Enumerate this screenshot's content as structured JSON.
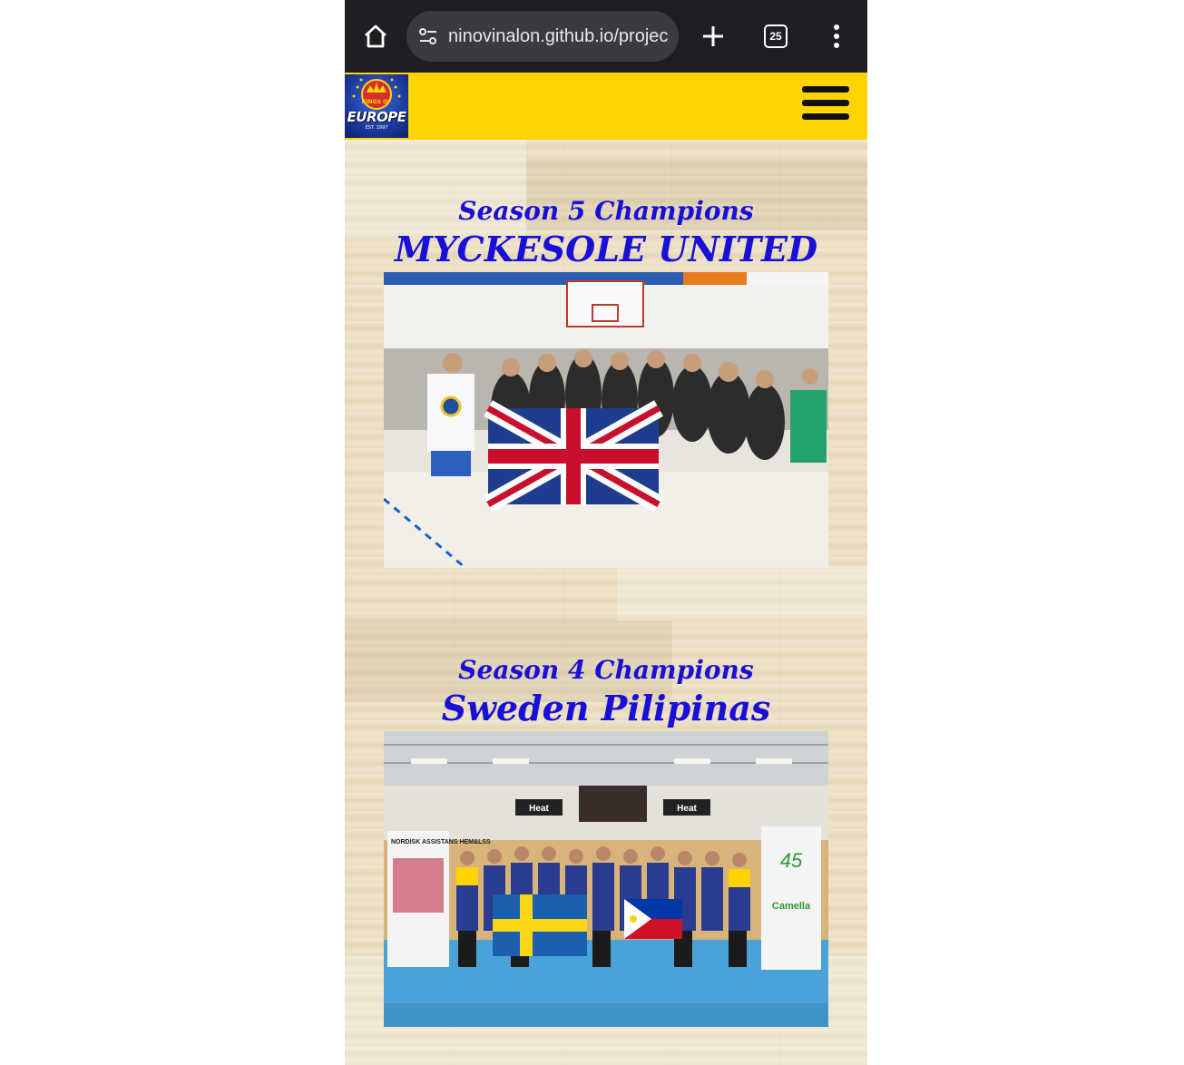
{
  "browser": {
    "url": "ninovinalon.github.io/projec",
    "tab_count": "25"
  },
  "site": {
    "logo_top": "KINGS OF",
    "logo_word": "EUROPE",
    "logo_est": "EST. 1997"
  },
  "sections": [
    {
      "subtitle": "Season 5 Champions",
      "title": "MYCKESOLE UNITED"
    },
    {
      "subtitle": "Season 4 Champions",
      "title": "Sweden Pilipinas"
    }
  ],
  "photo2": {
    "banner_left": "NORDISK ASSISTANS HEM&LSS",
    "banner_right_year": "45",
    "banner_right_brand": "Camella",
    "sign_heat": "Heat"
  },
  "colors": {
    "header_yellow": "#ffd400",
    "title_blue": "#1a0fd6",
    "chrome_dark": "#1e1f22"
  }
}
